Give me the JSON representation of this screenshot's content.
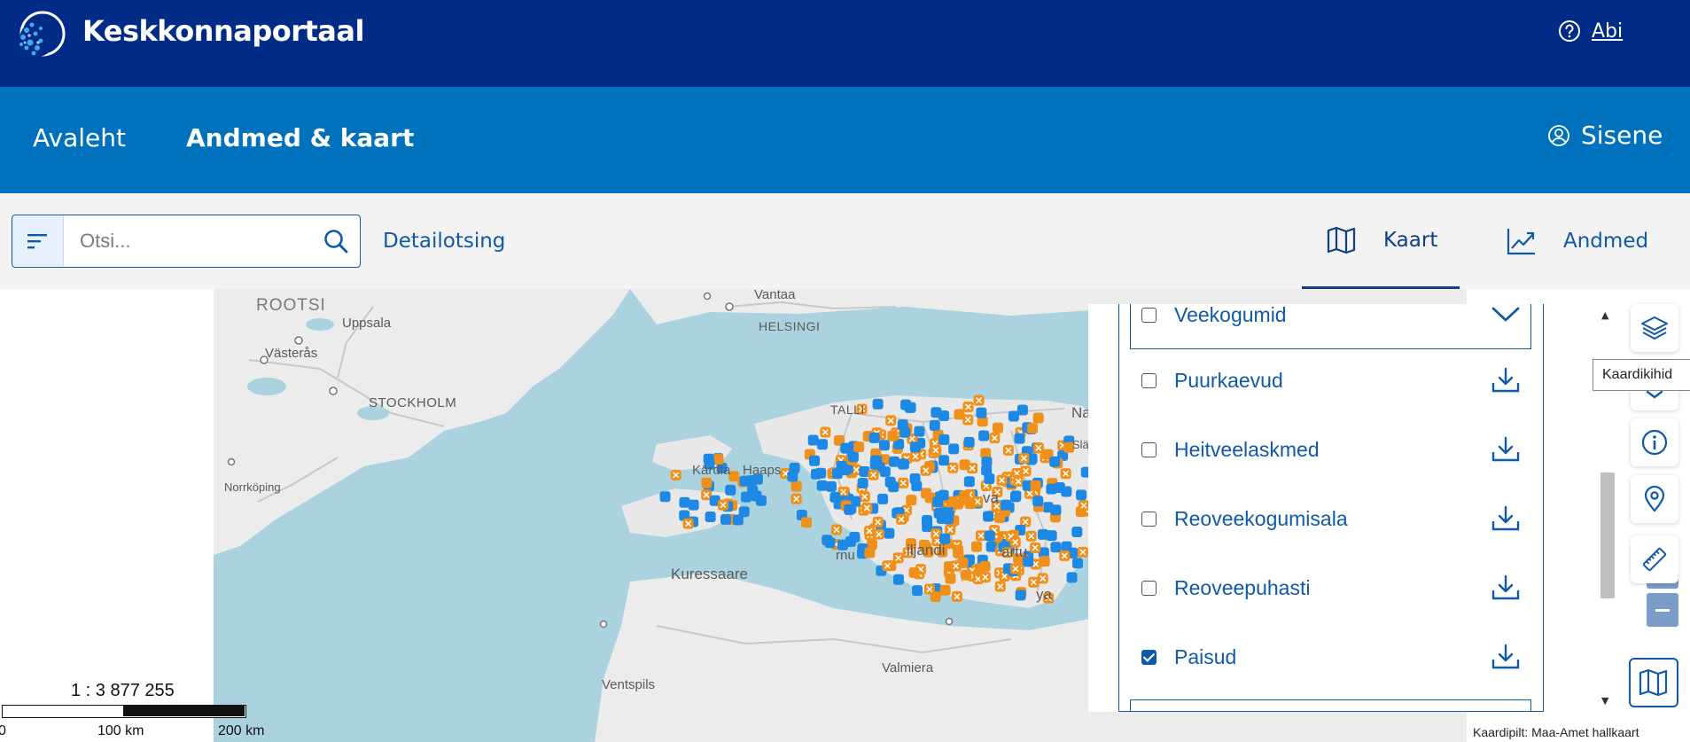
{
  "header": {
    "brand": "Keskkonnaportaal",
    "help_label": "Abi"
  },
  "nav": {
    "home": "Avaleht",
    "data_map": "Andmed & kaart",
    "login": "Sisene"
  },
  "search": {
    "placeholder": "Otsi...",
    "value": "",
    "detail_link": "Detailotsing"
  },
  "view_tabs": [
    {
      "label": "Kaart",
      "icon": "map-icon",
      "active": true
    },
    {
      "label": "Andmed",
      "icon": "chart-trend-icon",
      "active": false
    }
  ],
  "map": {
    "labels": {
      "rootsi": "ROOTSI",
      "uppsala": "Uppsala",
      "vasteras": "Västerås",
      "stockholm": "STOCKHOLM",
      "norrkoping": "Norrköping",
      "vantaa": "Vantaa",
      "helsingi": "HELSINGI",
      "tallinn": "TALLI",
      "kardla": "Kärdla",
      "haapsalu": "Haaps",
      "kuressaare": "Kuressaare",
      "parnu": "rnu",
      "viljandi": "iljandi",
      "tartu": "artu",
      "voru": "ya",
      "rakvere": "va",
      "narva": "Na",
      "sla": "Slä",
      "valmiera": "Valmiera",
      "ventspils": "Ventspils"
    },
    "marker_colors": {
      "blue": "#1e88e5",
      "orange": "#f0901a"
    }
  },
  "scale": {
    "ratio": "1 : 3 877 255",
    "ticks": [
      "0",
      "100 km",
      "200 km"
    ]
  },
  "layers_panel": {
    "top_group": {
      "label": "Veekogumid",
      "checked": false
    },
    "items": [
      {
        "label": "Puurkaevud",
        "checked": false
      },
      {
        "label": "Heitveelaskmed",
        "checked": false
      },
      {
        "label": "Reoveekogumisala",
        "checked": false
      },
      {
        "label": "Reoveepuhasti",
        "checked": false
      },
      {
        "label": "Paisud",
        "checked": true
      }
    ]
  },
  "toolbar": {
    "tooltip": "Kaardikihid"
  },
  "attribution": "Kaardipilt: Maa-Amet hallkaart"
}
